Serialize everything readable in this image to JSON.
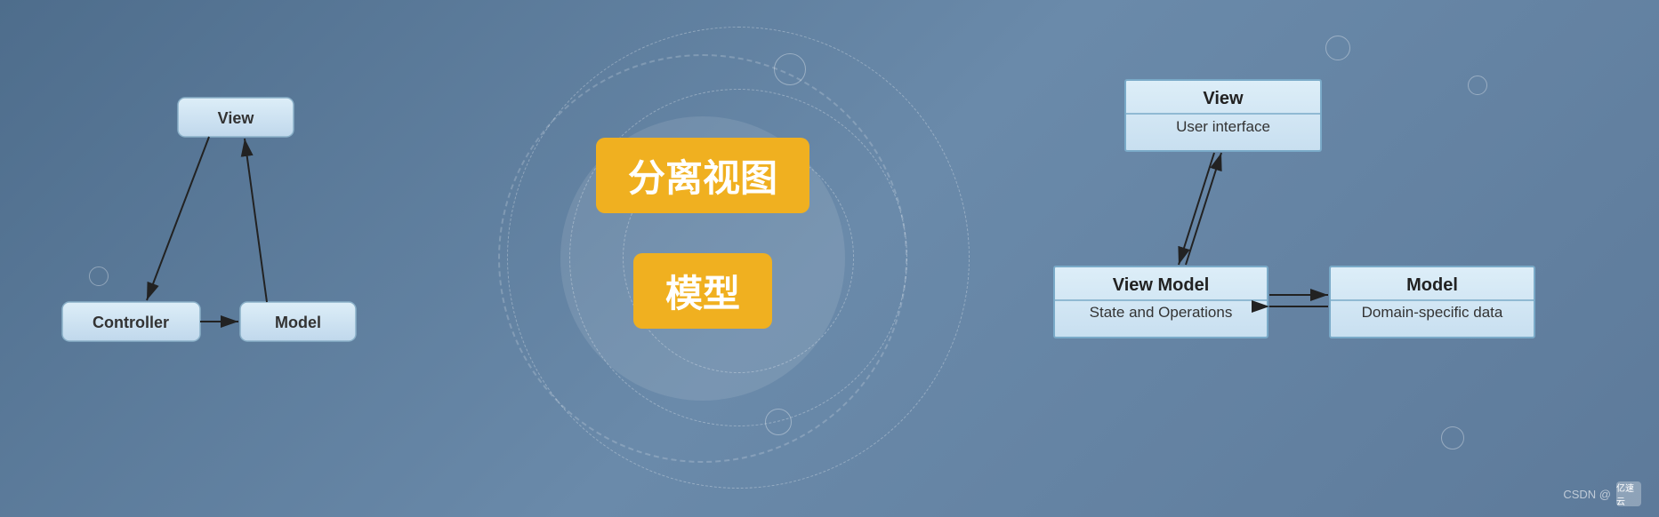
{
  "background_color": "#5d7a9a",
  "mvc": {
    "view_label": "View",
    "controller_label": "Controller",
    "model_label": "Model"
  },
  "center": {
    "label1": "分离视图",
    "label2": "模型"
  },
  "mvvm": {
    "view_header": "View",
    "view_body": "User interface",
    "viewmodel_header": "View Model",
    "viewmodel_body": "State and Operations",
    "model_header": "Model",
    "model_body": "Domain-specific data"
  },
  "watermark": {
    "text": "CSDN @",
    "logo_text": "亿速云"
  }
}
